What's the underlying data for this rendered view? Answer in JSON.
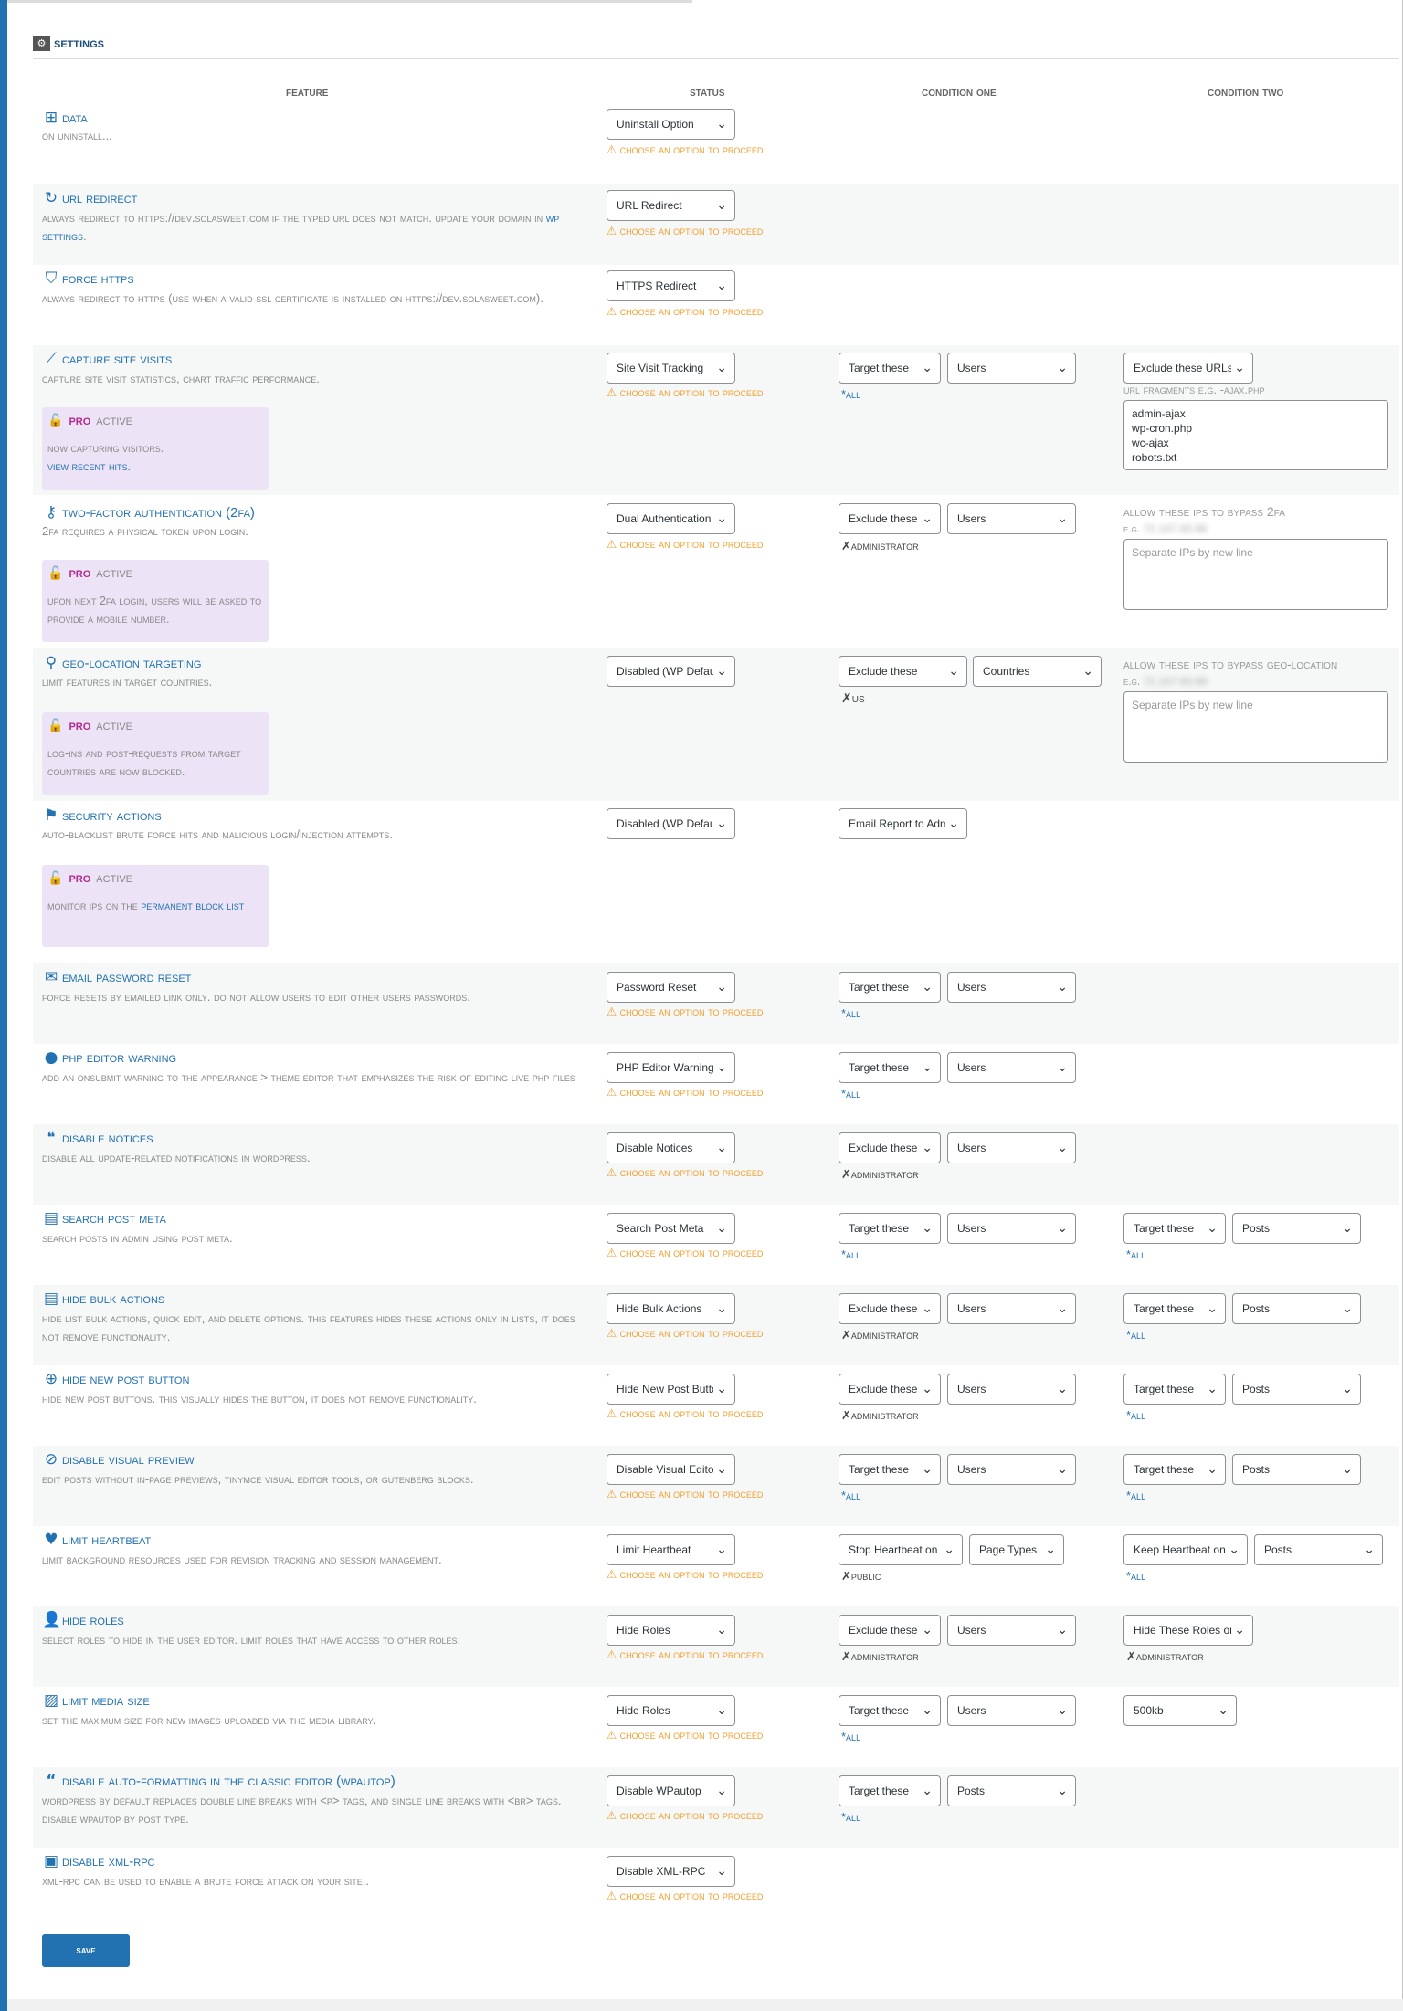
{
  "page_title": "Settings",
  "columns": [
    "Feature",
    "Status",
    "Condition One",
    "Condition Two"
  ],
  "warn_text": "⚠ Choose an option to proceed",
  "pro": {
    "label": "Pro",
    "active": "active"
  },
  "rows": {
    "data": {
      "title": "Data",
      "desc": "On uninstall...",
      "status": "Uninstall Option"
    },
    "url_redirect": {
      "title": "URL Redirect",
      "desc_pre": "Always redirect to https://dev.solasweet.com if the typed URL does not match. Update your domain in ",
      "desc_link": "WP Settings",
      "desc_post": ".",
      "status": "URL Redirect"
    },
    "force_https": {
      "title": "Force HTTPS",
      "desc": "Always Redirect to HTTPS (Use when a valid SSL certificate is installed on https://dev.solasweet.com).",
      "status": "HTTPS Redirect"
    },
    "capture": {
      "title": "Capture Site Visits",
      "desc": "Capture site visit statistics, chart traffic performance.",
      "status": "Site Visit Tracking",
      "c1a": "Target these",
      "c1b": "Users",
      "c1tag": "*All",
      "c2a": "Exclude these URLs",
      "c2sub": "URL fragments e.g. -ajax.php",
      "c2text": "admin-ajax\nwp-cron.php\nwc-ajax\nrobots.txt",
      "pro_desc": "Now capturing visitors.",
      "pro_link": "View recent hits."
    },
    "twofa": {
      "title": "Two-Factor Authentication (2FA)",
      "desc": "2FA requires a physical token upon login.",
      "status": "Dual Authentication",
      "c1a": "Exclude these",
      "c1b": "Users",
      "c1tag": "✗administrator",
      "c2sub": "Allow these IPs to Bypass 2FA",
      "c2eg": "e.g.",
      "c2egval": "72.107.93.86",
      "c2ph": "Separate IPs by new line",
      "pro_desc": "Upon next 2FA login, users will be asked to provide a mobile number."
    },
    "geo": {
      "title": "Geo-Location Targeting",
      "desc": "Limit features in target countries.",
      "status": "Disabled (WP Default)",
      "c1a": "Exclude these",
      "c1b": "Countries",
      "c1tag": "✗US",
      "c2sub": "Allow these IPs to Bypass Geo-Location",
      "c2eg": "e.g.",
      "c2egval": "72.107.93.86",
      "c2ph": "Separate IPs by new line",
      "pro_desc": "Log-ins and post-requests from target countries are now blocked."
    },
    "security": {
      "title": "Security Actions",
      "desc": "Auto-blacklist brute force hits and malicious login/injection attempts.",
      "status": "Disabled (WP Default)",
      "c1a": "Email Report to Admin",
      "pro_desc": "Monitor IPs on the ",
      "pro_link": "Permanent Block List"
    },
    "email_reset": {
      "title": "Email Password Reset",
      "desc": "Force resets by emailed link only. Do not allow users to edit other users passwords.",
      "status": "Password Reset",
      "c1a": "Target these",
      "c1b": "Users",
      "c1tag": "*All"
    },
    "php_editor": {
      "title": "PHP Editor Warning",
      "desc": "Add an onsubmit warning to the Appearance > Theme Editor that emphasizes the risk of editing live PHP files",
      "status": "PHP Editor Warning",
      "c1a": "Target these",
      "c1b": "Users",
      "c1tag": "*All"
    },
    "notices": {
      "title": "Disable Notices",
      "desc": "Disable all update-related notifications in WordPress.",
      "status": "Disable Notices",
      "c1a": "Exclude these",
      "c1b": "Users",
      "c1tag": "✗administrator"
    },
    "search_meta": {
      "title": "Search Post Meta",
      "desc": "Search posts in admin using post meta.",
      "status": "Search Post Meta",
      "c1a": "Target these",
      "c1b": "Users",
      "c1tag": "*All",
      "c2a": "Target these",
      "c2b": "Posts",
      "c2tag": "*All"
    },
    "bulk": {
      "title": "Hide Bulk Actions",
      "desc": "Hide list bulk actions, quick edit, and delete options. This features hides these actions only in lists, it does not remove functionality.",
      "status": "Hide Bulk Actions",
      "c1a": "Exclude these",
      "c1b": "Users",
      "c1tag": "✗administrator",
      "c2a": "Target these",
      "c2b": "Posts",
      "c2tag": "*All"
    },
    "new_post": {
      "title": "Hide New Post Button",
      "desc": "Hide new post buttons. This visually hides the button, it does not remove functionality.",
      "status": "Hide New Post Button",
      "c1a": "Exclude these",
      "c1b": "Users",
      "c1tag": "✗administrator",
      "c2a": "Target these",
      "c2b": "Posts",
      "c2tag": "*All"
    },
    "visual": {
      "title": "Disable Visual Preview",
      "desc": "Edit posts without in-page previews, TinyMCE visual editor tools, or Gutenberg blocks.",
      "status": "Disable Visual Editor",
      "c1a": "Target these",
      "c1b": "Users",
      "c1tag": "*All",
      "c2a": "Target these",
      "c2b": "Posts",
      "c2tag": "*All"
    },
    "heartbeat": {
      "title": "Limit Heartbeat",
      "desc": "Limit background resources used for revision tracking and session management.",
      "status": "Limit Heartbeat",
      "c1a": "Stop Heartbeat on",
      "c1b": "Page Types",
      "c1tag": "✗Public",
      "c2a": "Keep Heartbeat on",
      "c2b": "Posts",
      "c2tag": "*All"
    },
    "roles": {
      "title": "Hide Roles",
      "desc": "Select roles to hide in the user editor. Limit roles that have access to other roles.",
      "status": "Hide Roles",
      "c1a": "Exclude these",
      "c1b": "Users",
      "c1tag": "✗administrator",
      "c2a": "Hide These Roles on",
      "c2tag": "✗administrator"
    },
    "media": {
      "title": "Limit Media Size",
      "desc": "Set the maximum size for new images uploaded via the media library.",
      "status": "Hide Roles",
      "c1a": "Target these",
      "c1b": "Users",
      "c1tag": "*All",
      "c2a": "500kb"
    },
    "wpautop": {
      "title": "Disable Auto-formatting in the Classic Editor (WPautop)",
      "desc": "WordPress by default replaces double line breaks with <p> tags, and single line breaks with <br> tags. Disable wpautop by post type.",
      "status": "Disable WPautop",
      "c1a": "Target these",
      "c1b": "Posts",
      "c1tag": "*All"
    },
    "xmlrpc": {
      "title": "Disable XML-RPC",
      "desc": "XML-RPC can be used to enable a brute force attack on your site..",
      "status": "Disable XML-RPC"
    }
  },
  "save_label": "Save"
}
